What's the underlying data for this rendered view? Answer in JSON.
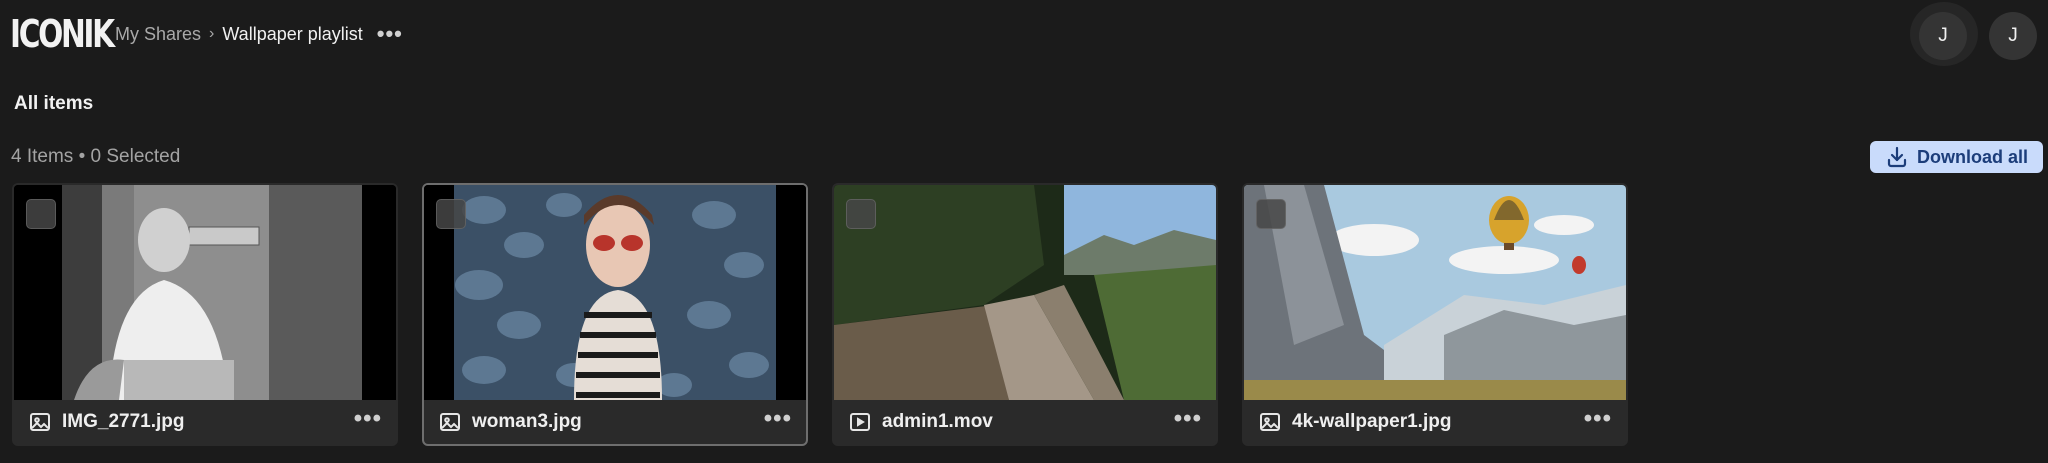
{
  "header": {
    "logo": "ICONIK",
    "breadcrumb": {
      "root": "My Shares",
      "separator": "›",
      "current": "Wallpaper playlist",
      "more": "•••"
    },
    "avatars": [
      "J",
      "J"
    ]
  },
  "main": {
    "section_title": "All items",
    "count_text": "4 Items • 0 Selected",
    "download_all_label": "Download all",
    "items": [
      {
        "filename": "IMG_2771.jpg",
        "type_icon": "image-icon",
        "more": "•••",
        "selected": false
      },
      {
        "filename": "woman3.jpg",
        "type_icon": "image-icon",
        "more": "•••",
        "selected": false
      },
      {
        "filename": "admin1.mov",
        "type_icon": "video-icon",
        "more": "•••",
        "selected": false
      },
      {
        "filename": "4k-wallpaper1.jpg",
        "type_icon": "image-icon",
        "more": "•••",
        "selected": false
      }
    ]
  },
  "colors": {
    "background": "#1b1b1b",
    "card": "#2a2a2a",
    "accent_button_bg": "#c9dbfb",
    "accent_button_text": "#1c3d7a"
  }
}
